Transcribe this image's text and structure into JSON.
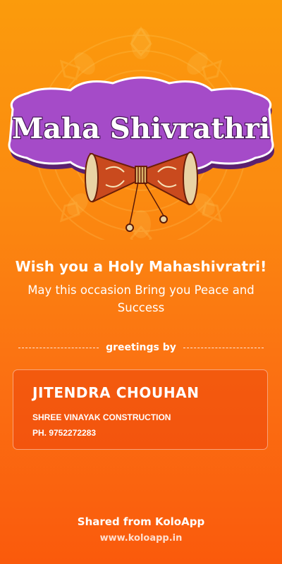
{
  "banner": {
    "title": "Maha Shivrathri"
  },
  "message": {
    "headline": "Wish you a Holy Mahashivratri!",
    "subline": "May this occasion Bring you Peace and Success"
  },
  "greetings": {
    "label": "greetings by"
  },
  "sender": {
    "name": "JITENDRA CHOUHAN",
    "company": "SHREE VINAYAK CONSTRUCTION",
    "phone": "PH. 9752272283"
  },
  "footer": {
    "shared_text": "Shared from KoloApp",
    "website": "www.koloapp.in"
  },
  "colors": {
    "background_top": "#fb9b0c",
    "background_bottom": "#fa5a0c",
    "banner_purple": "#a54bc8",
    "banner_outline": "#4a1a5c",
    "damru_body": "#c94a1e"
  },
  "icons": [
    "mandala-decoration",
    "damru-drum-illustration"
  ]
}
